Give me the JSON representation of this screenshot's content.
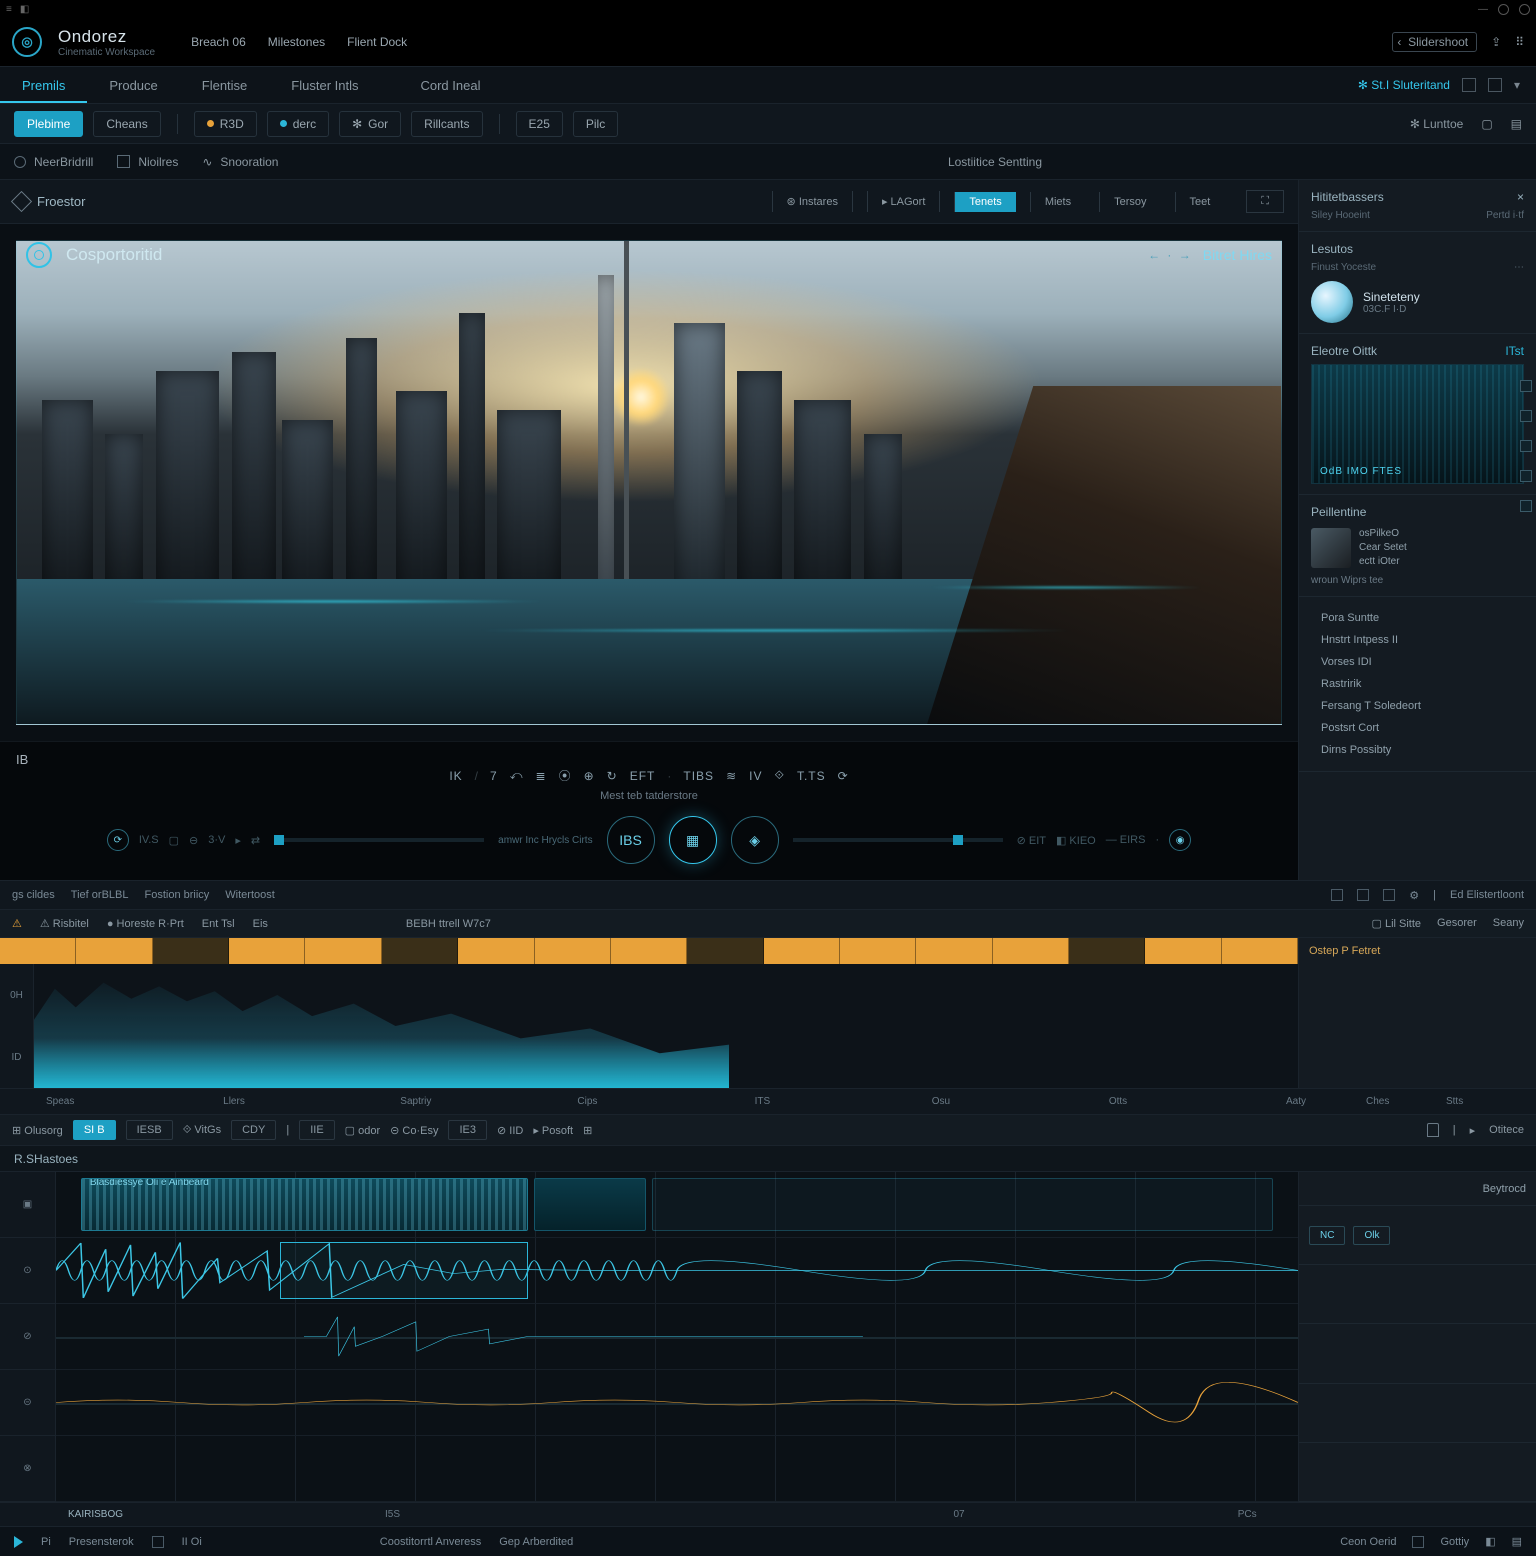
{
  "app": {
    "name": "Ondorez",
    "subtitle": "Cinematic Workspace"
  },
  "title_menu": [
    "Breach 06",
    "Milestones",
    "Flient Dock"
  ],
  "title_right": {
    "prev": "‹",
    "label": "Slidershoot",
    "share_icon": "share-icon"
  },
  "tabs": {
    "items": [
      "Premils",
      "Produce",
      "Flentise",
      "Fluster Intls",
      "Cord Ineal"
    ],
    "active": 0,
    "right": {
      "share": "St.I  Sluteritand",
      "export": "⇪"
    }
  },
  "toolrow": {
    "buttons": [
      {
        "label": "Plebime",
        "variant": "primary"
      },
      {
        "label": "Cheans"
      },
      {
        "label": "R3D",
        "dot": true
      },
      {
        "label": "derc",
        "dot": true
      },
      {
        "label": "Gor"
      },
      {
        "label": "Rillcants"
      },
      {
        "label": "E25"
      },
      {
        "label": "Pilc"
      }
    ],
    "right": [
      "Lunttoe",
      "▢",
      "▤"
    ]
  },
  "optbar": {
    "groups": [
      {
        "icon": "radio",
        "label": "NeerBridrill"
      },
      {
        "icon": "square",
        "label": "Nioilres"
      },
      {
        "icon": "wave",
        "label": "Snooration"
      }
    ],
    "right_label": "Lostiitice Sentting"
  },
  "preview_header": {
    "title": "Froestor",
    "left_pills": [
      "Instares",
      "LAGort"
    ],
    "right_pills": [
      "Tenets",
      "Miets",
      "Tersoy",
      "Teet"
    ],
    "active_right": 0
  },
  "viewport": {
    "overlay_title": "Cosportoritid",
    "overlay_right": "Bitret Hires",
    "nav": "← · →"
  },
  "transport": {
    "left_cap": "IB",
    "tokens": [
      "IK",
      "7",
      "⤺",
      "≣",
      "⦿",
      "⊕",
      "↻",
      "EFT",
      "·",
      "TIBS",
      "≋",
      "IV",
      "⟐",
      "T.TS",
      "⟳"
    ],
    "subcaption": "Mest teb tatderstore",
    "scrub_label": "amwr Inc  Hrycls Cirts",
    "left_meta": [
      "⟳",
      "IV.S",
      "▢",
      "⊖",
      "3·V",
      "▸",
      "⇄"
    ],
    "play_label": "IBS",
    "center_icons": [
      "▦",
      "◈"
    ],
    "right_meta": [
      "⊘ EIT",
      "◧ KIEO",
      "— EIRS",
      "·",
      "◉"
    ]
  },
  "side": {
    "header": {
      "title": "Hititetbassers",
      "sub_l": "Siley Hooeint",
      "sub_r": "Pertd i·tf"
    },
    "lesutos": "Lesutos",
    "card": {
      "line1": "Finust Yoceste",
      "line2": ""
    },
    "profile": {
      "name": "Sineteteny",
      "detail": "03C.F I·D"
    },
    "effect_hdr": {
      "title": "Eleotre Oittk",
      "meta": "ITst"
    },
    "thumb_cap": "OdB IMO FTES",
    "asset_hdr": "Peillentine",
    "asset": {
      "l1": "osPilkeO",
      "l2": "Cear Setet",
      "l3": "ectt iOter"
    },
    "asset_sub": {
      "l": "wroun  Wiprs tee",
      "r": ""
    },
    "list": [
      "Pora Suntte",
      "Hnstrt Intpess  II",
      "Vorses IDI",
      "Rastririk",
      "Fersang T  Soledeort",
      "Postsrt Cort",
      "Dirns Possibty"
    ],
    "float_icons": [
      "a",
      "b",
      "c",
      "d",
      "e"
    ]
  },
  "tl_toolbar": {
    "left": [
      "gs cildes",
      "Tief orBLBL",
      "Fostion briicy",
      "Witertoost"
    ],
    "right": [
      "⊞",
      "⊟",
      "▢",
      "⚙",
      "|",
      "Ed Elistertloont"
    ]
  },
  "tl_hdr": {
    "left": [
      "⚠ Risbitel",
      "● Horeste  R·Prt",
      "Ent Tsl",
      "Eis"
    ],
    "center": "BEBH ttrell  W7c7",
    "mid_right": [
      "▢ Lil Sitte",
      "Gesorer",
      "Seany"
    ],
    "right_cap": "Ostep P Fetret"
  },
  "wave_labels": [
    "0H",
    "ID"
  ],
  "ruler_upper": [
    "Speas",
    "Llers",
    "Saptriy",
    "Cips",
    "ITS",
    "Osu",
    "Otts"
  ],
  "ruler_upper_right": [
    "Aaty",
    "Ches",
    "Stts"
  ],
  "tl2": {
    "left_label": "Olusorg",
    "chips": [
      "SI B",
      "IESB",
      "⟐ VitGs",
      "CDY",
      "|",
      "IIE",
      "▢ odor",
      "⊝ Co·Esy",
      "IE3",
      "⊘ IID",
      "▸ Posoft",
      "⊞"
    ],
    "chip_on": 0,
    "right": [
      "🔒",
      "|",
      "▸",
      "Otitece"
    ]
  },
  "multi": {
    "title": "R.SHastoes",
    "clip_label": "Blasdiessye Oli e Ainbeard",
    "right_hdr": "Beytrocd",
    "right_chips": [
      "NC",
      "Olk"
    ],
    "track_heads": [
      "▣",
      "⊙",
      "⊘",
      "⊝",
      "⊗"
    ]
  },
  "bottom_ruler": {
    "first": "KAIRIS",
    "items": [
      "BOG",
      "I5S",
      "",
      "07",
      "PCs"
    ]
  },
  "status": {
    "left": [
      "Pi",
      "Presensterok",
      "",
      "II  Oi"
    ],
    "center": [
      "Coostitorrtl Anveress",
      "Gep Arberdited"
    ],
    "right": [
      "Ceon Oerid",
      "▢",
      "Gottiy",
      "◧",
      "▤"
    ]
  },
  "colors": {
    "accent": "#1da0c4",
    "glow": "#35c7ed",
    "amber": "#e8a23a"
  }
}
